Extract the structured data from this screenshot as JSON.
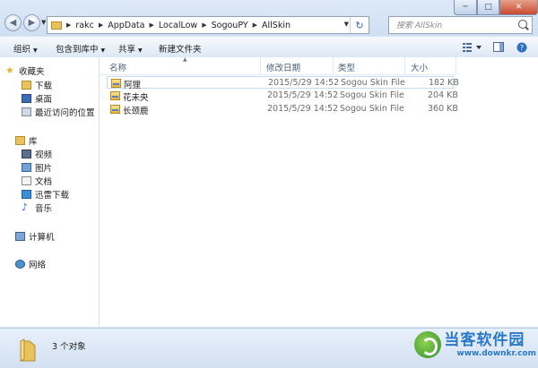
{
  "window": {
    "controls": {
      "minimize": "─",
      "maximize": "□",
      "close": "✕"
    }
  },
  "address_bar": {
    "breadcrumbs": [
      "rakc",
      "AppData",
      "LocalLow",
      "SogouPY",
      "AllSkin"
    ],
    "search_placeholder": "搜索 AllSkin"
  },
  "toolbar": {
    "organize": "组织",
    "include_in_library": "包含到库中",
    "share": "共享",
    "new_folder": "新建文件夹"
  },
  "nav": {
    "favorites": {
      "label": "收藏夹",
      "items": [
        "下载",
        "桌面",
        "最近访问的位置"
      ]
    },
    "libraries": {
      "label": "库",
      "items": [
        "视频",
        "图片",
        "文档",
        "迅雷下载",
        "音乐"
      ]
    },
    "computer": "计算机",
    "network": "网络"
  },
  "columns": {
    "name": "名称",
    "modified": "修改日期",
    "type": "类型",
    "size": "大小"
  },
  "files": [
    {
      "name": "阿狸",
      "modified": "2015/5/29 14:52",
      "type": "Sogou Skin File",
      "size": "182 KB"
    },
    {
      "name": "花未央",
      "modified": "2015/5/29 14:52",
      "type": "Sogou Skin File",
      "size": "204 KB"
    },
    {
      "name": "长颈鹿",
      "modified": "2015/5/29 14:52",
      "type": "Sogou Skin File",
      "size": "360 KB"
    }
  ],
  "status": {
    "item_count": "3 个对象"
  },
  "watermark": {
    "title": "当客软件园",
    "url": "www.downkr.com"
  },
  "colors": {
    "frame": "#dbe8f6",
    "selection_border": "#c7daf1",
    "close_button": "#c74a2c",
    "watermark": "#2a79c8"
  }
}
